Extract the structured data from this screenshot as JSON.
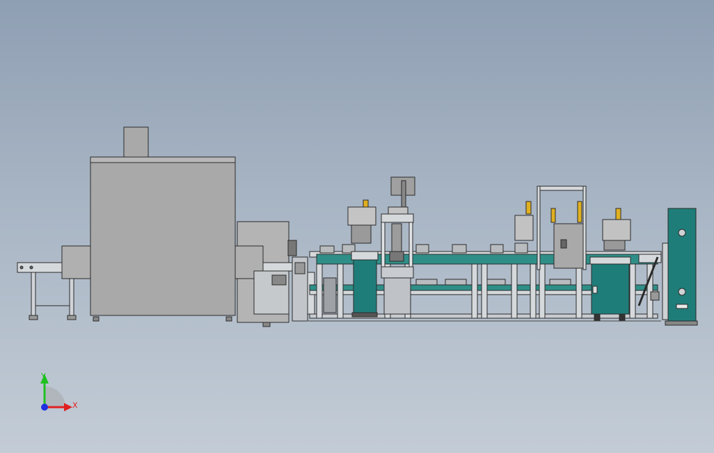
{
  "colors": {
    "background_top": "#8f9fb3",
    "background_bottom": "#c3ccd6",
    "housing_gray": "#a9a9a9",
    "panel_gray": "#b4b4b4",
    "frame_light": "#d6d9dc",
    "teal_cabinet": "#1f7d79",
    "teal_conveyor": "#2f8f88",
    "outline": "#2a2a2a",
    "axis_x": "#e02020",
    "axis_y": "#20c020",
    "axis_z": "#2030e0"
  },
  "triad": {
    "x_label": "X",
    "y_label": "Y"
  },
  "icons": {
    "axis_triad": "coordinate-triad-icon",
    "control_cabinet": "cabinet-icon",
    "cylinder": "pneumatic-cylinder-icon"
  }
}
